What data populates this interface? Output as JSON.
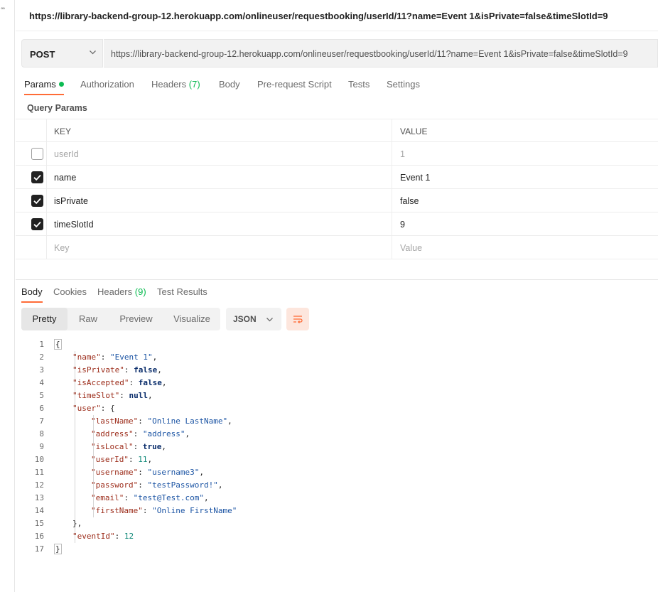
{
  "app": {
    "window_title": "https://library-backend-group-12.herokuapp.com/onlineuser/requestbooking/userId/11?name=Event 1&isPrivate=false&timeSlotId=9"
  },
  "request": {
    "method": "POST",
    "url": "https://library-backend-group-12.herokuapp.com/onlineuser/requestbooking/userId/11?name=Event 1&isPrivate=false&timeSlotId=9"
  },
  "request_tabs": [
    {
      "label": "Params",
      "count": ""
    },
    {
      "label": "Authorization",
      "count": ""
    },
    {
      "label": "Headers",
      "count": "(7)"
    },
    {
      "label": "Body",
      "count": ""
    },
    {
      "label": "Pre-request Script",
      "count": ""
    },
    {
      "label": "Tests",
      "count": ""
    },
    {
      "label": "Settings",
      "count": ""
    }
  ],
  "query_params": {
    "section_label": "Query Params",
    "headers": {
      "key": "KEY",
      "value": "VALUE"
    },
    "rows": [
      {
        "key": "userId",
        "value": "1",
        "checked": false
      },
      {
        "key": "name",
        "value": "Event 1",
        "checked": true
      },
      {
        "key": "isPrivate",
        "value": "false",
        "checked": true
      },
      {
        "key": "timeSlotId",
        "value": "9",
        "checked": true
      }
    ],
    "new_row": {
      "key_placeholder": "Key",
      "value_placeholder": "Value"
    }
  },
  "response_tabs": [
    {
      "label": "Body",
      "count": ""
    },
    {
      "label": "Cookies",
      "count": ""
    },
    {
      "label": "Headers",
      "count": "(9)"
    },
    {
      "label": "Test Results",
      "count": ""
    }
  ],
  "response_toolbar": {
    "views": [
      "Pretty",
      "Raw",
      "Preview",
      "Visualize"
    ],
    "active_view": "Pretty",
    "format": "JSON"
  },
  "response_body": {
    "line_numbers": [
      "1",
      "2",
      "3",
      "4",
      "5",
      "6",
      "7",
      "8",
      "9",
      "10",
      "11",
      "12",
      "13",
      "14",
      "15",
      "16",
      "17"
    ],
    "lines": [
      "{",
      "\"name\": \"Event 1\",",
      "\"isPrivate\": false,",
      "\"isAccepted\": false,",
      "\"timeSlot\": null,",
      "\"user\": {",
      "\"lastName\": \"Online LastName\",",
      "\"address\": \"address\",",
      "\"isLocal\": true,",
      "\"userId\": 11,",
      "\"username\": \"username3\",",
      "\"password\": \"testPassword!\",",
      "\"email\": \"test@Test.com\",",
      "\"firstName\": \"Online FirstName\"",
      "},",
      "\"eventId\": 12",
      "}"
    ]
  },
  "colors": {
    "accent": "#ff6c37",
    "success": "#0cbb52",
    "json_key": "#9c2c1a",
    "json_string": "#1a53a3",
    "json_number": "#128a7a"
  }
}
